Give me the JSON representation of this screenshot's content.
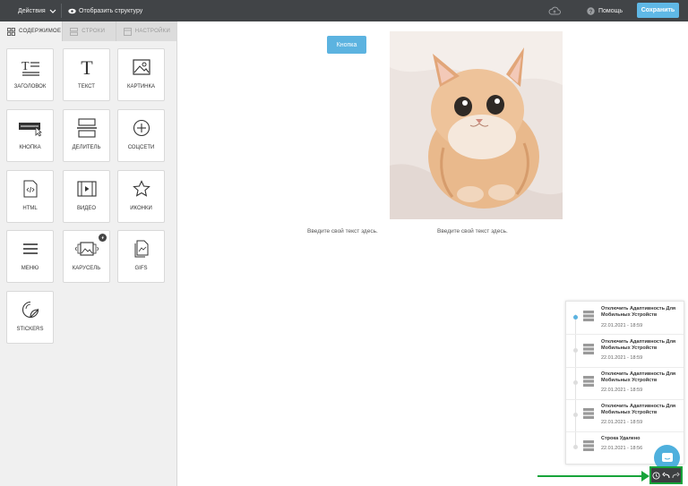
{
  "topbar": {
    "actions_label": "Действия",
    "show_structure_label": "Отобразить структуру",
    "help_label": "Помощь",
    "save_label": "Сохранить"
  },
  "sidebar": {
    "tabs": [
      {
        "label": "СОДЕРЖИМОЕ",
        "active": true
      },
      {
        "label": "СТРОКИ",
        "active": false
      },
      {
        "label": "НАСТРОЙКИ",
        "active": false
      }
    ],
    "tiles": [
      {
        "label": "ЗАГОЛОВОК",
        "icon": "heading-icon"
      },
      {
        "label": "ТЕКСТ",
        "icon": "text-icon"
      },
      {
        "label": "КАРТИНКА",
        "icon": "image-icon"
      },
      {
        "label": "КНОПКА",
        "icon": "button-icon"
      },
      {
        "label": "ДЕЛИТЕЛЬ",
        "icon": "divider-icon"
      },
      {
        "label": "СОЦСЕТИ",
        "icon": "social-icon"
      },
      {
        "label": "HTML",
        "icon": "html-icon"
      },
      {
        "label": "ВИДЕО",
        "icon": "video-icon"
      },
      {
        "label": "ИКОНКИ",
        "icon": "star-icon"
      },
      {
        "label": "МЕНЮ",
        "icon": "menu-icon"
      },
      {
        "label": "КАРУСЕЛЬ",
        "icon": "carousel-icon"
      },
      {
        "label": "GIFS",
        "icon": "gif-icon"
      },
      {
        "label": "STICKERS",
        "icon": "sticker-icon"
      }
    ]
  },
  "canvas": {
    "button_label": "Кнопка",
    "text_left": "Введите свой текст здесь.",
    "text_right": "Введите свой текст здесь."
  },
  "history": {
    "items": [
      {
        "title": "Отключить Адаптивность Для Мобильных Устройств",
        "date": "22.01.2021 - 18:59",
        "active": true
      },
      {
        "title": "Отключить Адаптивность Для Мобильных Устройств",
        "date": "22.01.2021 - 18:59",
        "active": false
      },
      {
        "title": "Отключить Адаптивность Для Мобильных Устройств",
        "date": "22.01.2021 - 18:59",
        "active": false
      },
      {
        "title": "Отключить Адаптивность Для Мобильных Устройств",
        "date": "22.01.2021 - 18:59",
        "active": false
      },
      {
        "title": "Строка Удалено",
        "date": "22.01.2021 - 18:56",
        "active": false
      }
    ]
  },
  "colors": {
    "topbar": "#414447",
    "accent": "#5fb8e6",
    "highlight": "#17a43a"
  }
}
